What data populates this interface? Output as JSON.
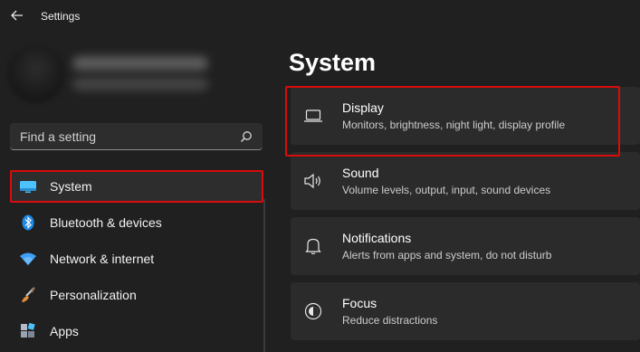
{
  "app": {
    "title": "Settings"
  },
  "search": {
    "placeholder": "Find a setting"
  },
  "nav": {
    "items": [
      {
        "label": "System",
        "icon": "monitor-icon"
      },
      {
        "label": "Bluetooth & devices",
        "icon": "bluetooth-icon"
      },
      {
        "label": "Network & internet",
        "icon": "wifi-icon"
      },
      {
        "label": "Personalization",
        "icon": "brush-icon"
      },
      {
        "label": "Apps",
        "icon": "apps-icon"
      }
    ]
  },
  "main": {
    "title": "System",
    "cards": [
      {
        "title": "Display",
        "desc": "Monitors, brightness, night light, display profile",
        "icon": "laptop-icon"
      },
      {
        "title": "Sound",
        "desc": "Volume levels, output, input, sound devices",
        "icon": "speaker-icon"
      },
      {
        "title": "Notifications",
        "desc": "Alerts from apps and system, do not disturb",
        "icon": "bell-icon"
      },
      {
        "title": "Focus",
        "desc": "Reduce distractions",
        "icon": "focus-icon"
      }
    ]
  },
  "colors": {
    "background": "#202020",
    "card": "#2b2b2b",
    "active_nav": "#2d2d2d",
    "highlight": "#d90b0b",
    "system_icon": "#4cc2ff",
    "bluetooth_icon": "#1e88e5",
    "wifi_icon": "#3ea1f5"
  }
}
